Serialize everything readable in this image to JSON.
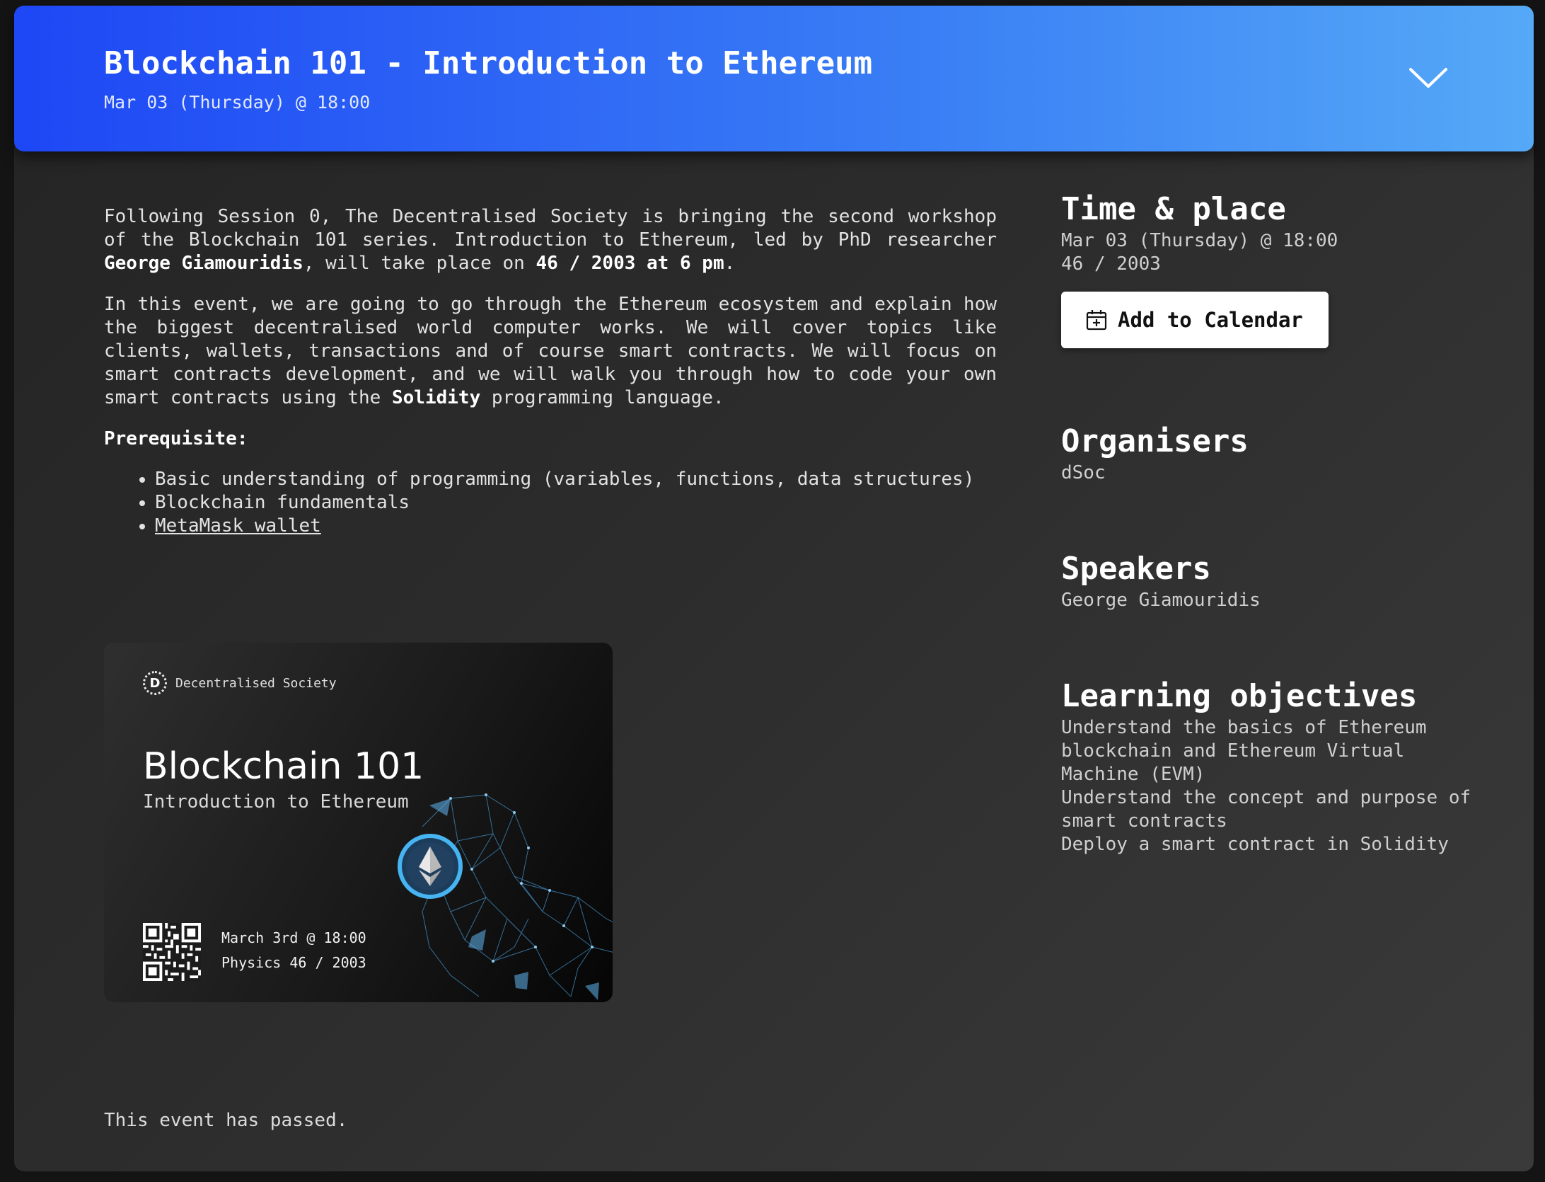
{
  "header": {
    "title": "Blockchain 101 - Introduction to Ethereum",
    "subtitle": "Mar 03 (Thursday) @ 18:00",
    "toggle_icon": "chevron-down-icon"
  },
  "description": {
    "p1_part1": "Following Session 0, The Decentralised Society is bringing the second workshop of the Blockchain 101 series. Introduction to Ethereum, led by PhD researcher ",
    "p1_bold1": "George Giamouridis",
    "p1_part2": ", will take place on ",
    "p1_bold2": "46 / 2003 at 6 pm",
    "p1_part3": ".",
    "p2_part1": "In this event, we are going to go through the Ethereum ecosystem and explain how the biggest decentralised world computer works. We will cover topics like clients, wallets, transactions and of course smart contracts. We will focus on smart contracts development, and we will walk you through how to code your own smart contracts using the ",
    "p2_bold": "Solidity",
    "p2_part2": " programming language.",
    "prereq_title": "Prerequisite:",
    "prereqs": [
      "Basic understanding of programming (variables, functions, data structures)",
      "Blockchain fundamentals",
      "MetaMask wallet"
    ]
  },
  "banner": {
    "org_name": "Decentralised Society",
    "org_logo_letter": "D",
    "title": "Blockchain 101",
    "subtitle": "Introduction to Ethereum",
    "date": "March 3rd @ 18:00",
    "place": "Physics 46 / 2003"
  },
  "sidebar": {
    "time_place": {
      "title": "Time & place",
      "when": "Mar 03 (Thursday) @ 18:00",
      "where": "46 / 2003",
      "calendar_button": "Add to Calendar",
      "calendar_icon": "calendar-plus-icon"
    },
    "organisers": {
      "title": "Organisers",
      "value": "dSoc"
    },
    "speakers": {
      "title": "Speakers",
      "value": "George Giamouridis"
    },
    "objectives": {
      "title": "Learning objectives",
      "items": [
        "Understand the basics of Ethereum blockchain and Ethereum Virtual Machine (EVM)",
        "Understand the concept and purpose of smart contracts",
        "Deploy a smart contract in Solidity"
      ]
    }
  },
  "footer": {
    "status": "This event has passed."
  },
  "colors": {
    "header_start": "#1e47f5",
    "header_end": "#55a9f7",
    "card_bg": "#2c2c2c",
    "button_bg": "#ffffff"
  }
}
